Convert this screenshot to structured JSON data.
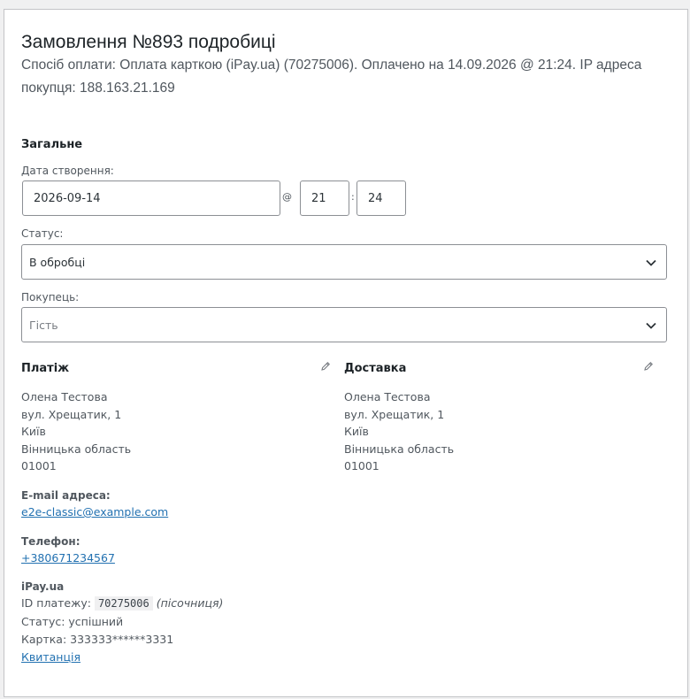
{
  "order": {
    "title": "Замовлення №893 подробиці",
    "meta": "Спосіб оплати: Оплата карткою (iPay.ua) (70275006). Оплачено на 14.09.2026 @ 21:24. IP адреса покупця: 188.163.21.169"
  },
  "general": {
    "heading": "Загальне",
    "date_label": "Дата створення:",
    "date_value": "2026-09-14",
    "at_sign": "@",
    "hour_value": "21",
    "colon": ":",
    "minute_value": "24",
    "status_label": "Статус:",
    "status_value": "В обробці",
    "customer_label": "Покупець:",
    "customer_value": "Гість"
  },
  "billing": {
    "heading": "Платіж",
    "address": [
      "Олена Тестова",
      "вул. Хрещатик, 1",
      "Київ",
      "Вінницька область",
      "01001"
    ],
    "email_label": "E-mail адреса:",
    "email": "e2e-classic@example.com",
    "phone_label": "Телефон:",
    "phone": "+380671234567"
  },
  "shipping": {
    "heading": "Доставка",
    "address": [
      "Олена Тестова",
      "вул. Хрещатик, 1",
      "Київ",
      "Вінницька область",
      "01001"
    ]
  },
  "ipay": {
    "heading": "iPay.ua",
    "payment_id_label": "ID платежу:",
    "payment_id": "70275006",
    "sandbox": "(пісочниця)",
    "status_text": "Статус: успішний",
    "card_text": "Картка: 333333******3331",
    "receipt_link": "Квитанція"
  },
  "colors": {
    "link": "#2271b1",
    "border": "#8c8f94"
  },
  "icons": {
    "select_arrow": "chevron-down-icon",
    "edit": "pencil-icon"
  }
}
